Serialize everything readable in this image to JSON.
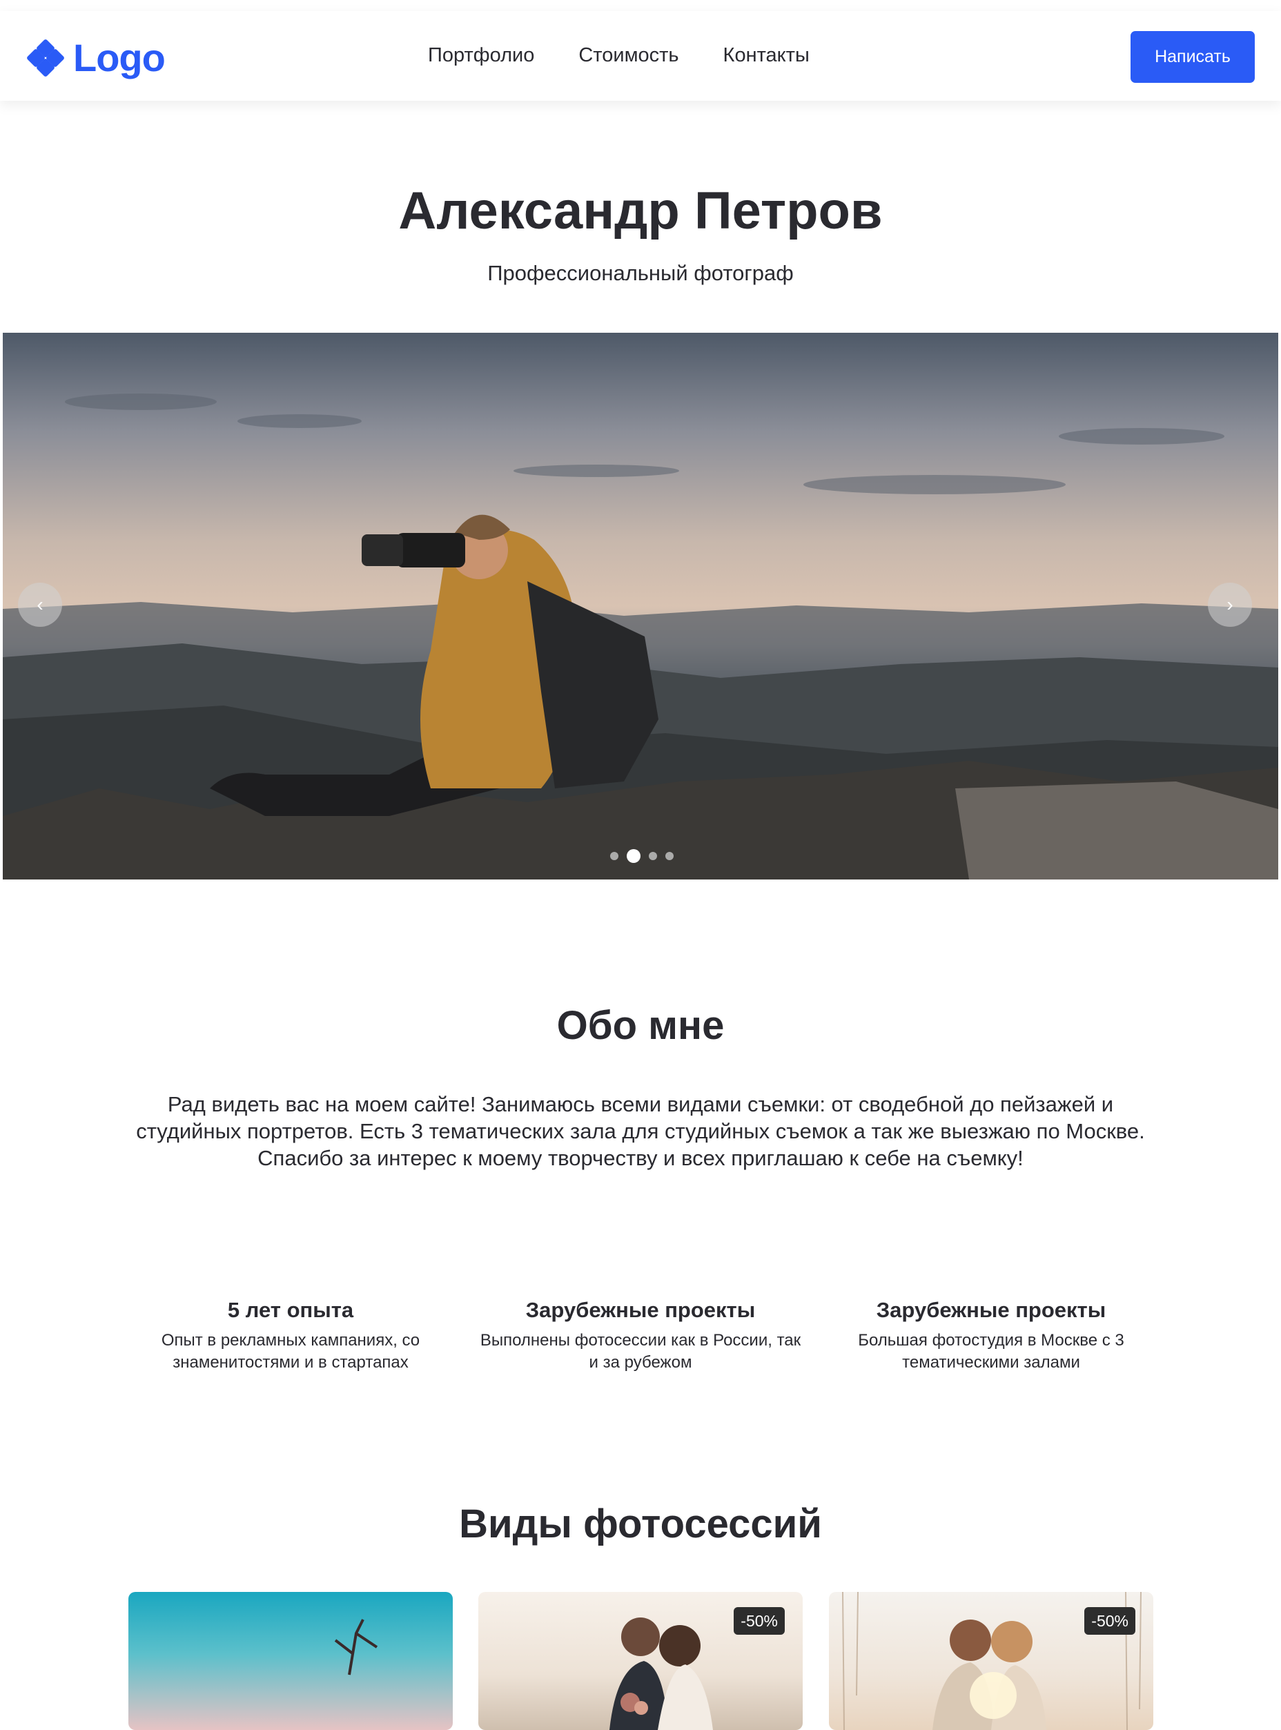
{
  "header": {
    "logo_text": "Logo",
    "nav": [
      "Портфолио",
      "Стоимость",
      "Контакты"
    ],
    "cta_label": "Написать",
    "accent_color": "#2a5bf6"
  },
  "hero": {
    "title": "Александр Петров",
    "subtitle": "Профессиональный фотограф"
  },
  "slider": {
    "prev_icon": "chevron-left-icon",
    "next_icon": "chevron-right-icon",
    "slide_count": 4,
    "active_slide": 2
  },
  "about": {
    "title": "Обо мне",
    "text": "Рад видеть вас на моем сайте! Занимаюсь всеми видами съемки: от сводебной до пейзажей и студийных портретов. Есть 3 тематических зала для студийных съемок а так же выезжаю по Москве. Спасибо за интерес к моему творчеству и всех приглашаю к себе на съемку!"
  },
  "features": [
    {
      "title": "5 лет опыта",
      "text": "Опыт в рекламных кампаниях, со знаменитостями и в стартапах"
    },
    {
      "title": "Зарубежные проекты",
      "text": "Выполнены фотосессии как в России, так и за рубежом"
    },
    {
      "title": "Зарубежные проекты",
      "text": "Большая фотостудия в Москве с 3 тематическими залами"
    }
  ],
  "sessions": {
    "title": "Виды фотосессий",
    "cards": [
      {
        "badge": ""
      },
      {
        "badge": "-50%"
      },
      {
        "badge": "-50%"
      }
    ]
  }
}
